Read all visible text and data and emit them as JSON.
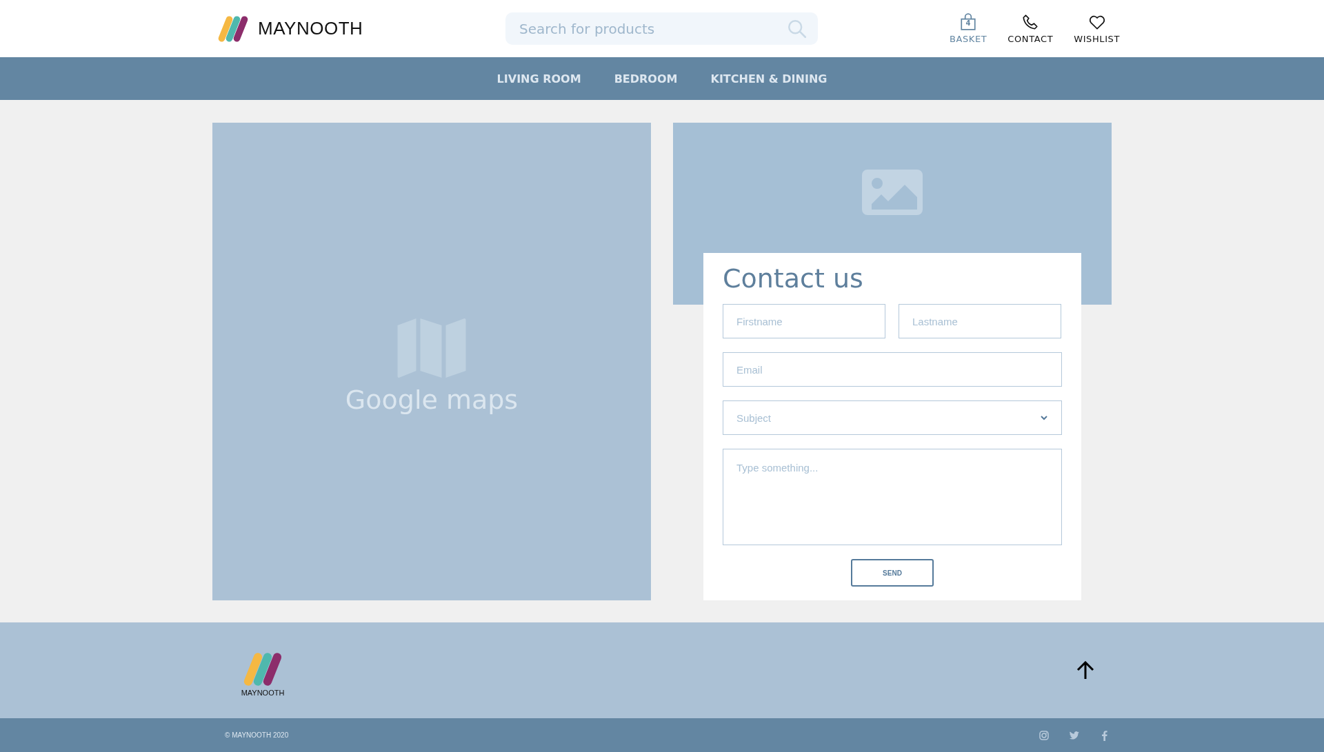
{
  "header": {
    "logo": "MAYNOOTH",
    "search": {
      "placeholder": "Search for products"
    },
    "actions": [
      {
        "kind": "basket",
        "label": "BASKET",
        "badge": "4",
        "selected": true
      },
      {
        "kind": "contact",
        "label": "CONTACT",
        "selected": false
      },
      {
        "kind": "wishlist",
        "label": "WISHLIST",
        "selected": false
      }
    ]
  },
  "nav": [
    "LIVING ROOM",
    "BEDROOM",
    "KITCHEN & DINING"
  ],
  "map": {
    "label": "Google maps"
  },
  "contact_form": {
    "title": "Contact us",
    "fields": [
      {
        "kind": "input",
        "placeholder": "Firstname"
      },
      {
        "kind": "input",
        "placeholder": "Lastname"
      },
      {
        "kind": "input",
        "placeholder": "Email"
      },
      {
        "kind": "select",
        "placeholder": "Subject"
      },
      {
        "kind": "textarea",
        "placeholder": "Type something..."
      }
    ],
    "send": "SEND"
  },
  "footer": {
    "logo": "MAYNOOTH",
    "copyright": "© MAYNOOTH 2020",
    "social": [
      {
        "kind": "instagram"
      },
      {
        "kind": "twitter"
      },
      {
        "kind": "facebook"
      }
    ]
  }
}
